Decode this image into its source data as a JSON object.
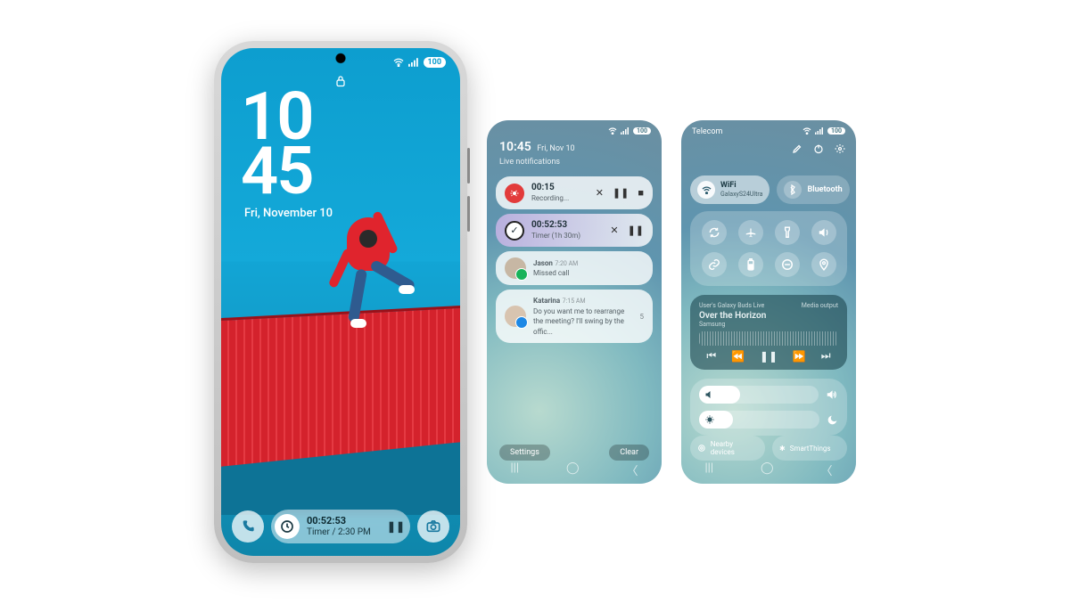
{
  "status": {
    "battery": "100"
  },
  "lockscreen": {
    "clock_top": "10",
    "clock_bottom": "45",
    "date": "Fri, November 10",
    "timer_value": "00:52:53",
    "timer_sub": "Timer / 2:30 PM"
  },
  "notif": {
    "header_time": "10:45",
    "header_date": "Fri, Nov 10",
    "section": "Live notifications",
    "rec": {
      "time": "00:15",
      "label": "Recording..."
    },
    "timer": {
      "time": "00:52:53",
      "label": "Timer (1h 30m)"
    },
    "jason": {
      "name": "Jason",
      "time": "7:20 AM",
      "body": "Missed call"
    },
    "katarina": {
      "name": "Katarina",
      "time": "7:15 AM",
      "body": "Do you want me to rearrange the meeting? I'll swing by the offic..."
    },
    "count": "5",
    "settings": "Settings",
    "clear": "Clear"
  },
  "qp": {
    "carrier": "Telecom",
    "wifi": {
      "label": "WiFi",
      "sub": "GalaxyS24Ultra"
    },
    "bt": {
      "label": "Bluetooth"
    },
    "media": {
      "device": "User's Galaxy Buds Live",
      "output": "Media output",
      "title": "Over the Horizon",
      "artist": "Samsung"
    },
    "nearby": "Nearby devices",
    "smart": "SmartThings"
  }
}
